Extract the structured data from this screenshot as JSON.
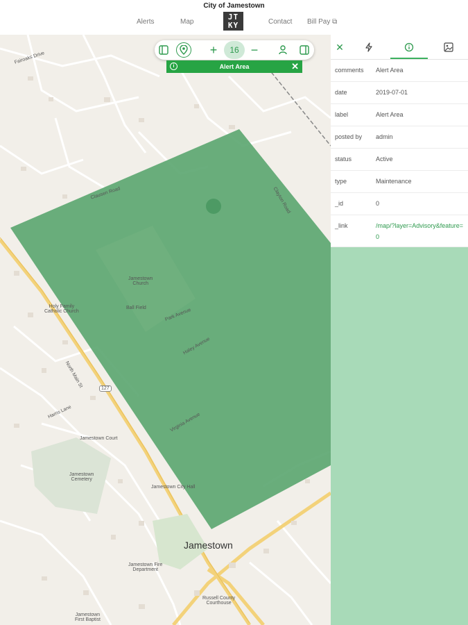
{
  "header": {
    "site_title": "City of Jamestown",
    "nav": {
      "alerts": "Alerts",
      "map": "Map",
      "contact": "Contact",
      "bill_pay": "Bill Pay ⧉"
    },
    "logo_text_top": "JT",
    "logo_text_bottom": "KY"
  },
  "toolbar": {
    "zoom_level": "16",
    "icons": [
      "sidebar-left-icon",
      "location-pin-icon",
      "zoom-in-icon",
      "zoom-out-icon",
      "user-icon",
      "sidebar-right-icon"
    ]
  },
  "alert_bar": {
    "title": "Alert Area"
  },
  "map": {
    "labels": {
      "fairoaks": "Fairoaks Drive",
      "clausen": "Clausen Road",
      "clayton": "Clayton Road",
      "school": "Jamestown\nChurch",
      "school_l1": "Jamestown",
      "school_l2": "Church",
      "holy_family_l1": "Holy Family",
      "holy_family_l2": "Catholic Church",
      "baseball": "Ball Field",
      "park_ave": "Park Avenue",
      "haley_ave": "Haley Avenue",
      "virginia_ave": "Virginia Avenue",
      "harris_lane": "Harris Lane",
      "jamestown_court": "Jamestown Court",
      "cemetery_l1": "Jamestown",
      "cemetery_l2": "Cemetery",
      "city_hall": "Jamestown City Hall",
      "town": "Jamestown",
      "fire_l1": "Jamestown Fire",
      "fire_l2": "Department",
      "courthouse_l1": "Russell County",
      "courthouse_l2": "Courthouse",
      "baptist_l1": "Jamestown",
      "baptist_l2": "First Baptist",
      "route": "127",
      "main_st": "North Main St"
    },
    "polygon_color": "#5aa56f",
    "accent": "#27a444"
  },
  "panel": {
    "properties": [
      {
        "key": "comments",
        "value": "Alert Area"
      },
      {
        "key": "date",
        "value": "2019-07-01"
      },
      {
        "key": "label",
        "value": "Alert Area"
      },
      {
        "key": "posted by",
        "value": "admin"
      },
      {
        "key": "status",
        "value": "Active"
      },
      {
        "key": "type",
        "value": "Maintenance"
      },
      {
        "key": "_id",
        "value": "0"
      },
      {
        "key": "_link",
        "value": "/map/?layer=Advisory&feature=0"
      }
    ],
    "background": "#a8dab8"
  }
}
